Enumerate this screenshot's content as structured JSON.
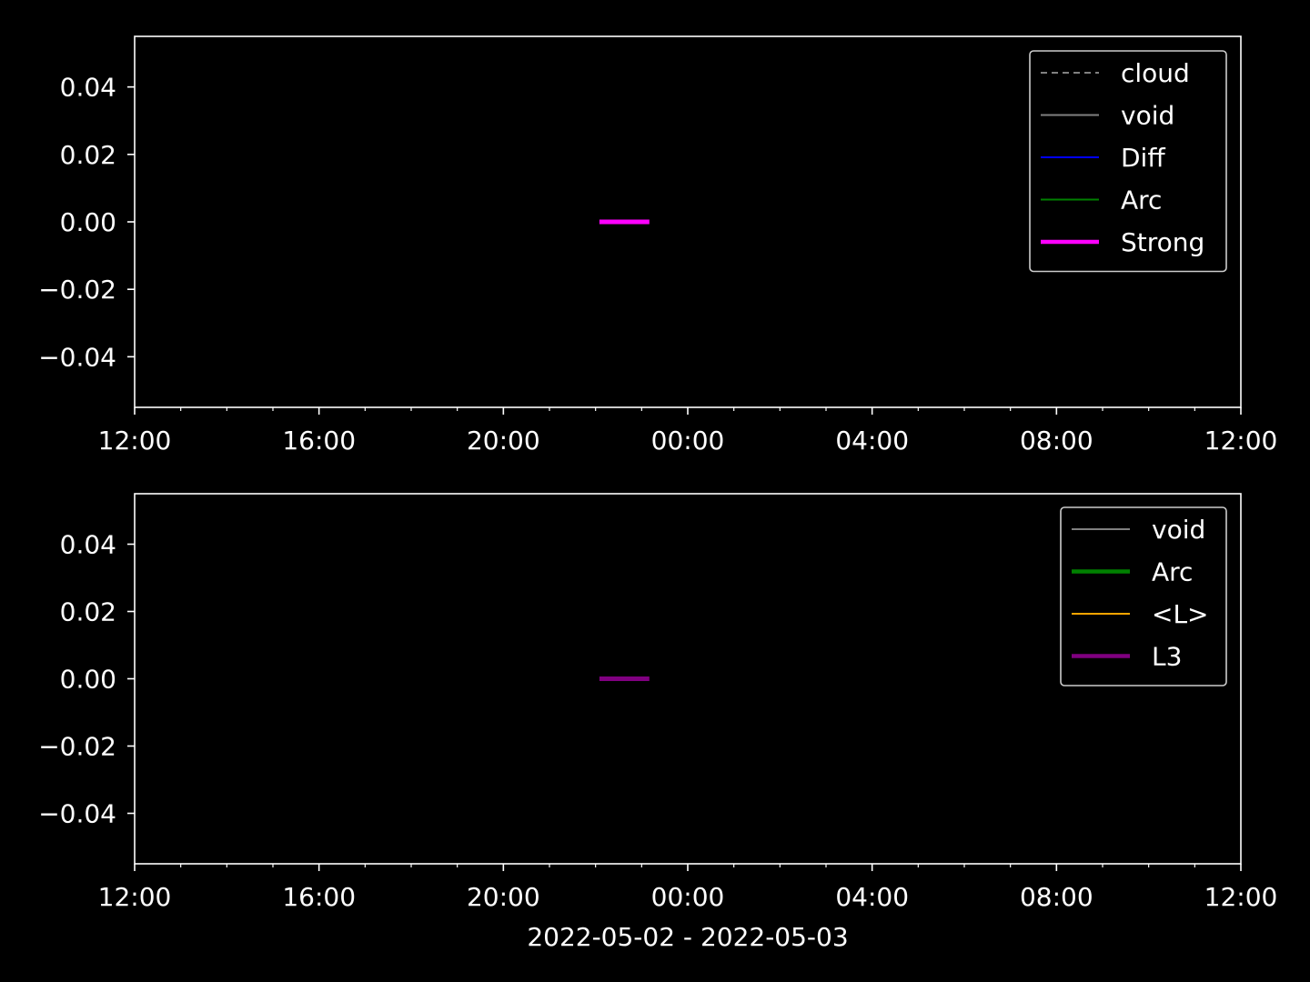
{
  "figure": {
    "background": "#000000",
    "foreground": "#ffffff",
    "xlabel": "2022-05-02 - 2022-05-03"
  },
  "chart_data": [
    {
      "type": "line",
      "panel": "top",
      "xlim": [
        "2022-05-02 12:00",
        "2022-05-03 12:00"
      ],
      "x_ticks": [
        "12:00",
        "16:00",
        "20:00",
        "00:00",
        "04:00",
        "08:00",
        "12:00"
      ],
      "x_minor_step_hours": 1,
      "ylim": [
        -0.055,
        0.055
      ],
      "y_ticks": [
        0.04,
        0.02,
        0.0,
        -0.02,
        -0.04
      ],
      "y_tick_labels": [
        "0.04",
        "0.02",
        "0.00",
        "−0.02",
        "−0.04"
      ],
      "grid": false,
      "legend_position": "top-right",
      "series": [
        {
          "name": "cloud",
          "color": "#808080",
          "style": "dashed",
          "width": "thin",
          "points": []
        },
        {
          "name": "void",
          "color": "#808080",
          "style": "solid",
          "width": "thin",
          "points": []
        },
        {
          "name": "Diff",
          "color": "#0000ff",
          "style": "solid",
          "width": "thin",
          "points": []
        },
        {
          "name": "Arc",
          "color": "#008000",
          "style": "solid",
          "width": "thin",
          "points": []
        },
        {
          "name": "Strong",
          "color": "#ff00ff",
          "style": "solid",
          "width": "thick",
          "points": [
            {
              "x": "2022-05-02 22:05",
              "y": 0.0
            },
            {
              "x": "2022-05-02 23:10",
              "y": 0.0
            }
          ]
        }
      ]
    },
    {
      "type": "line",
      "panel": "bottom",
      "xlim": [
        "2022-05-02 12:00",
        "2022-05-03 12:00"
      ],
      "x_ticks": [
        "12:00",
        "16:00",
        "20:00",
        "00:00",
        "04:00",
        "08:00",
        "12:00"
      ],
      "x_minor_step_hours": 1,
      "ylim": [
        -0.055,
        0.055
      ],
      "y_ticks": [
        0.04,
        0.02,
        0.0,
        -0.02,
        -0.04
      ],
      "y_tick_labels": [
        "0.04",
        "0.02",
        "0.00",
        "−0.02",
        "−0.04"
      ],
      "grid": false,
      "legend_position": "top-right",
      "series": [
        {
          "name": "void",
          "color": "#808080",
          "style": "solid",
          "width": "thin",
          "points": []
        },
        {
          "name": "Arc",
          "color": "#008000",
          "style": "solid",
          "width": "thick",
          "points": []
        },
        {
          "name": "<L>",
          "color": "#ffa500",
          "style": "solid",
          "width": "thin",
          "points": []
        },
        {
          "name": "L3",
          "color": "#800080",
          "style": "solid",
          "width": "thick",
          "points": [
            {
              "x": "2022-05-02 22:05",
              "y": 0.0
            },
            {
              "x": "2022-05-02 23:10",
              "y": 0.0
            }
          ]
        }
      ]
    }
  ]
}
